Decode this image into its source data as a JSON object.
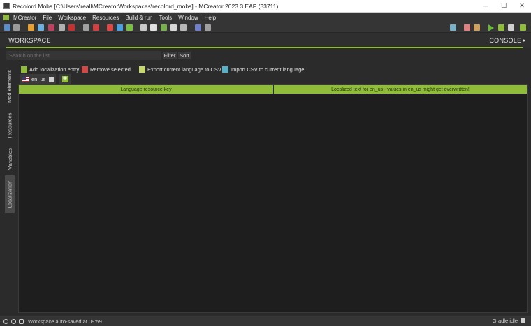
{
  "window": {
    "title": "Recolord Mobs [C:\\Users\\reall\\MCreatorWorkspaces\\recolord_mobs] - MCreator 2023.3 EAP (33711)",
    "minimize": "—",
    "maximize": "☐",
    "close": "✕"
  },
  "menu": [
    "MCreator",
    "File",
    "Workspace",
    "Resources",
    "Build & run",
    "Tools",
    "Window",
    "Help"
  ],
  "toolbar": {
    "left_icons": [
      "image-icon",
      "texture-icon",
      "mod-element-icon",
      "paint-icon",
      "tag-icon",
      "crafting-icon",
      "armor-icon",
      "gui-icon",
      "entity-icon",
      "block-icon",
      "structure-icon",
      "biome-icon",
      "map-icon",
      "paint-roller-icon",
      "plant-icon",
      "refresh-icon",
      "box-icon",
      "procedure-icon"
    ],
    "right_icons": [
      "folder-icon",
      "eraser-icon",
      "hammer-icon",
      "run-client-icon",
      "run-server-icon",
      "stop-icon",
      "export-icon"
    ]
  },
  "workspace_tab": "WORKSPACE",
  "console_tab": "CONSOLE",
  "search": {
    "placeholder": "Search on the list"
  },
  "filter_label": "Filter",
  "sort_label": "Sort",
  "sidebar": [
    "Mod elements",
    "Resources",
    "Variables",
    "Localization"
  ],
  "actions": {
    "add": "Add localization entry",
    "remove": "Remove selected",
    "export": "Export current language to CSV",
    "import": "Import CSV to current language"
  },
  "language_tab": "en_us",
  "table": {
    "columns": [
      "Language resource key",
      "Localized text for en_us - values in en_us might get overwritten!"
    ]
  },
  "status": {
    "message": "Workspace auto-saved at 09:59",
    "gradle": "Gradle idle"
  },
  "colors": {
    "accent": "#8fbc3a",
    "background": "#2b2b2b",
    "table_bg": "#1e1e1e"
  }
}
